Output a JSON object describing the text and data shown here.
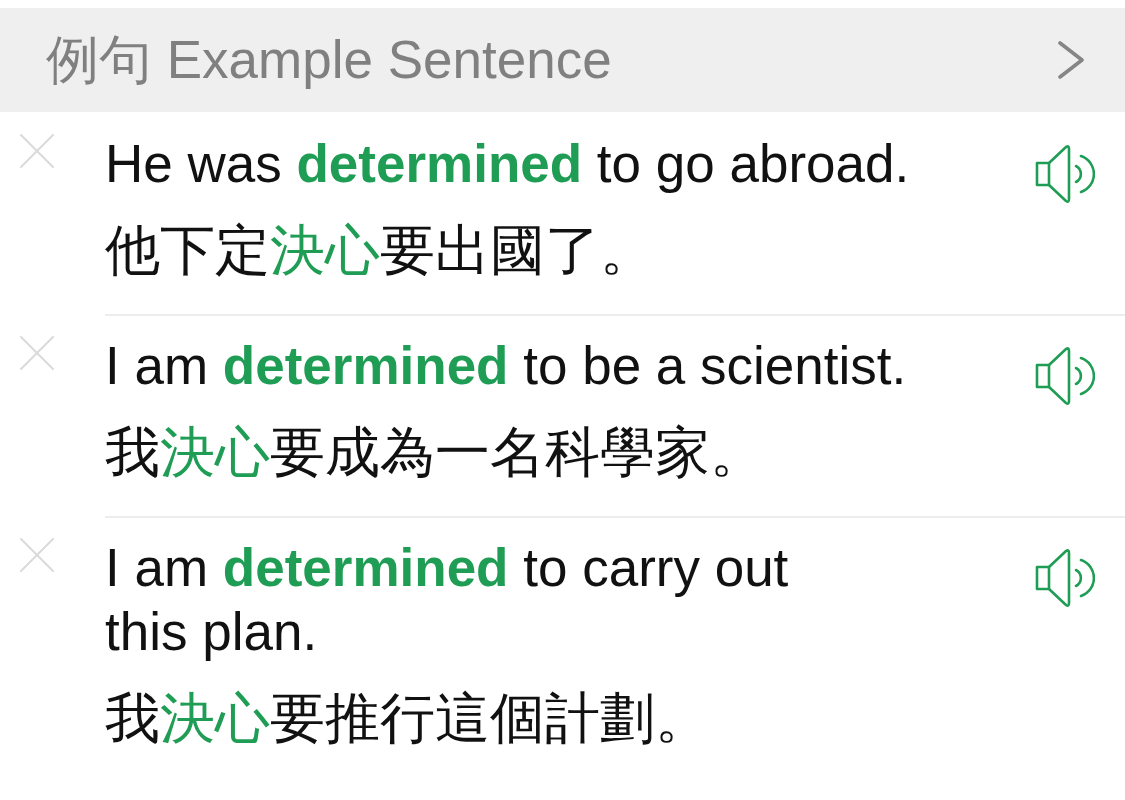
{
  "header": {
    "title": "例句 Example Sentence"
  },
  "sentences": [
    {
      "english": "He was **determined** to go abroad.",
      "chinese": "他下定**決心**要出國了。"
    },
    {
      "english": "I am **determined** to be a scientist.",
      "chinese": "我**決心**要成為一名科學家。"
    },
    {
      "english": "I am **determined** to carry out\nthis plan.",
      "chinese": "我**決心**要推行這個計劃。"
    }
  ]
}
